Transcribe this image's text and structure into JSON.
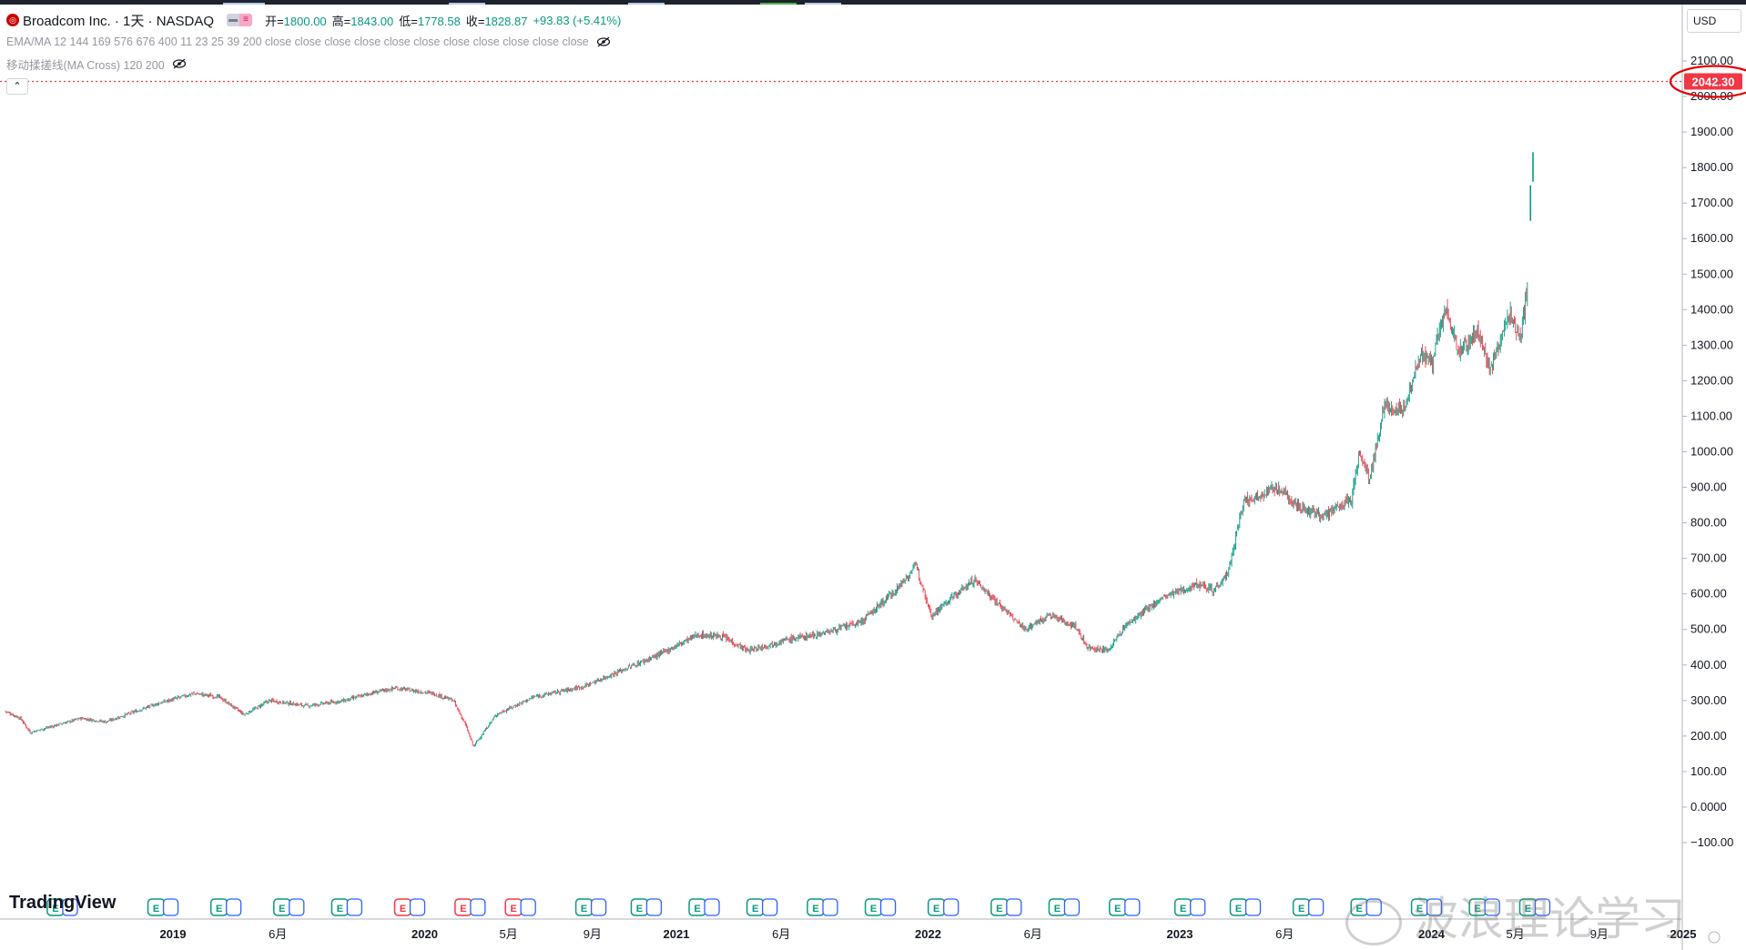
{
  "colors": {
    "up": "#089981",
    "down": "#f23645",
    "price_line": "#f23645",
    "annotation": "#e00000",
    "axis_text": "#131722",
    "grid_line": "#e0e3eb",
    "earnings": "#089981",
    "earnings_miss": "#f23645",
    "dividend": "#2962ff"
  },
  "legend": {
    "logo_icon": "broadcom-logo-icon",
    "symbol": "Broadcom Inc. · 1天 · NASDAQ",
    "open_label": "开=",
    "open": "1800.00",
    "high_label": "高=",
    "high": "1843.00",
    "low_label": "低=",
    "low": "1778.58",
    "close_label": "收=",
    "close": "1828.87",
    "change": "+93.83 (+5.41%)",
    "indicator1": "EMA/MA 12 144 169 576 676 400 11 23 25 39 200 close close close close close close close close close close close",
    "indicator2": "移动揉搓线(MA Cross) 120 200",
    "eye_icon": "eye-hidden-icon",
    "collapse_icon": "chevron-up-icon"
  },
  "price_axis": {
    "currency": "USD"
  },
  "price_label": "2042.30",
  "watermark": "波浪理论学习",
  "brand": "TradingView",
  "chart_data": {
    "type": "candlestick",
    "title": "Broadcom Inc. · 1天 · NASDAQ",
    "ylim": [
      -100,
      2100
    ],
    "y_ticks": [
      "2100.00",
      "2000.00",
      "1900.00",
      "1800.00",
      "1700.00",
      "1600.00",
      "1500.00",
      "1400.00",
      "1300.00",
      "1200.00",
      "1100.00",
      "1000.00",
      "900.00",
      "800.00",
      "700.00",
      "600.00",
      "500.00",
      "400.00",
      "300.00",
      "200.00",
      "100.00",
      "0.0000",
      "−100.00"
    ],
    "x_ticks": [
      {
        "label": "2019",
        "bold": true,
        "t": 0.6667
      },
      {
        "label": "6月",
        "bold": false,
        "t": 1.0833
      },
      {
        "label": "2020",
        "bold": true,
        "t": 1.6667
      },
      {
        "label": "5月",
        "bold": false,
        "t": 2.0
      },
      {
        "label": "9月",
        "bold": false,
        "t": 2.3333
      },
      {
        "label": "2021",
        "bold": true,
        "t": 2.6667
      },
      {
        "label": "6月",
        "bold": false,
        "t": 3.0833
      },
      {
        "label": "2022",
        "bold": true,
        "t": 3.6667
      },
      {
        "label": "6月",
        "bold": false,
        "t": 4.0833
      },
      {
        "label": "2023",
        "bold": true,
        "t": 4.6667
      },
      {
        "label": "6月",
        "bold": false,
        "t": 5.0833
      },
      {
        "label": "2024",
        "bold": true,
        "t": 5.6667
      },
      {
        "label": "5月",
        "bold": false,
        "t": 6.0
      },
      {
        "label": "9月",
        "bold": false,
        "t": 6.3333
      },
      {
        "label": "2025",
        "bold": true,
        "t": 6.6667
      }
    ],
    "price_path": [
      [
        0.0,
        270
      ],
      [
        0.06,
        250
      ],
      [
        0.1,
        210
      ],
      [
        0.2,
        230
      ],
      [
        0.3,
        250
      ],
      [
        0.4,
        240
      ],
      [
        0.5,
        265
      ],
      [
        0.6,
        290
      ],
      [
        0.75,
        320
      ],
      [
        0.85,
        310
      ],
      [
        0.95,
        260
      ],
      [
        1.05,
        300
      ],
      [
        1.2,
        285
      ],
      [
        1.35,
        300
      ],
      [
        1.45,
        320
      ],
      [
        1.55,
        335
      ],
      [
        1.7,
        320
      ],
      [
        1.78,
        300
      ],
      [
        1.83,
        230
      ],
      [
        1.86,
        170
      ],
      [
        1.95,
        260
      ],
      [
        2.1,
        310
      ],
      [
        2.3,
        340
      ],
      [
        2.5,
        400
      ],
      [
        2.6,
        430
      ],
      [
        2.75,
        485
      ],
      [
        2.85,
        480
      ],
      [
        2.95,
        440
      ],
      [
        3.1,
        470
      ],
      [
        3.25,
        490
      ],
      [
        3.4,
        520
      ],
      [
        3.55,
        620
      ],
      [
        3.62,
        680
      ],
      [
        3.68,
        540
      ],
      [
        3.78,
        600
      ],
      [
        3.85,
        640
      ],
      [
        3.95,
        570
      ],
      [
        4.05,
        500
      ],
      [
        4.15,
        540
      ],
      [
        4.25,
        510
      ],
      [
        4.3,
        450
      ],
      [
        4.38,
        440
      ],
      [
        4.45,
        510
      ],
      [
        4.6,
        590
      ],
      [
        4.75,
        630
      ],
      [
        4.8,
        610
      ],
      [
        4.86,
        660
      ],
      [
        4.92,
        860
      ],
      [
        5.05,
        900
      ],
      [
        5.15,
        840
      ],
      [
        5.25,
        820
      ],
      [
        5.35,
        870
      ],
      [
        5.38,
        1000
      ],
      [
        5.42,
        920
      ],
      [
        5.48,
        1130
      ],
      [
        5.55,
        1110
      ],
      [
        5.62,
        1270
      ],
      [
        5.67,
        1250
      ],
      [
        5.72,
        1400
      ],
      [
        5.78,
        1280
      ],
      [
        5.85,
        1340
      ],
      [
        5.9,
        1230
      ],
      [
        5.98,
        1390
      ],
      [
        6.02,
        1320
      ],
      [
        6.05,
        1480
      ]
    ],
    "spikes": [
      [
        6.06,
        1650,
        1750
      ],
      [
        6.07,
        1760,
        1843
      ]
    ]
  }
}
